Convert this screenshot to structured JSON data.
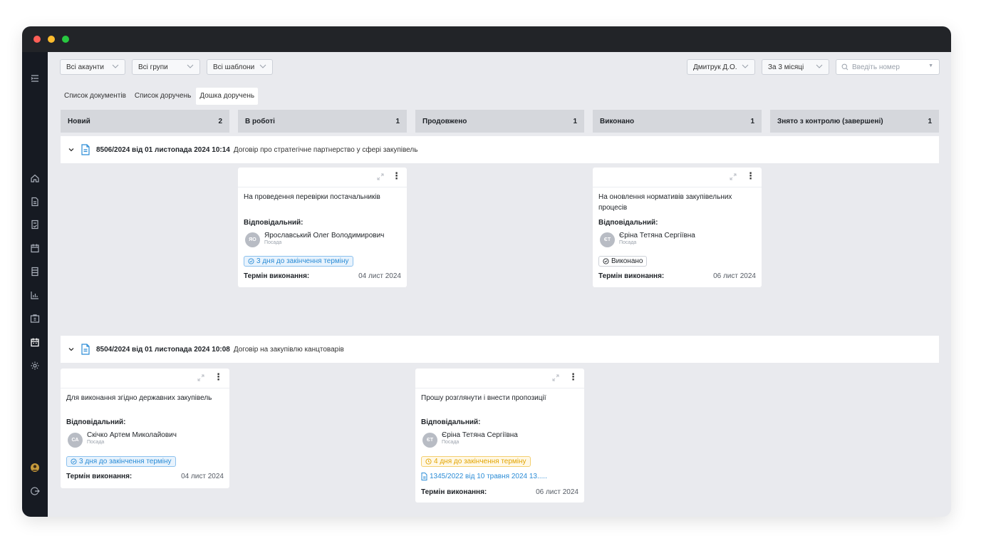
{
  "filters": {
    "accounts": "Всі акаунти",
    "groups": "Всі групи",
    "templates": "Всі шаблони",
    "user": "Дмитрук Д.О.",
    "period": "За 3 місяці",
    "search_placeholder": "Введіть номер"
  },
  "tabs": [
    {
      "label": "Список документів",
      "active": false
    },
    {
      "label": "Список доручень",
      "active": false
    },
    {
      "label": "Дошка доручень",
      "active": true
    }
  ],
  "columns": [
    {
      "label": "Новий",
      "count": "2"
    },
    {
      "label": "В роботі",
      "count": "1"
    },
    {
      "label": "Продовжено",
      "count": "1"
    },
    {
      "label": "Виконано",
      "count": "1"
    },
    {
      "label": "Знято з контролю (завершені)",
      "count": "1"
    }
  ],
  "groups": [
    {
      "number": "8506/2024 від 01 листопада 2024 10:14",
      "title": "Договір про стратегічне партнерство у сфері закупівель",
      "cards": [
        {
          "column": "В роботі",
          "title": "На проведення перевірки постачальників",
          "responsible_label": "Відповідальний:",
          "initials": "ЯО",
          "person": "Ярославський Олег Володимирович",
          "position": "Посада",
          "badge": "3 дня до закінчення терміну",
          "badge_type": "blue",
          "term_label": "Термін виконання:",
          "term_date": "04 лист 2024"
        },
        {
          "column": "Виконано",
          "title": "На оновлення нормативів закупівельних процесів",
          "responsible_label": "Відповідальний:",
          "initials": "ЄТ",
          "person": "Єріна Тетяна Сергіївна",
          "position": "Посада",
          "badge": "Виконано",
          "badge_type": "grey",
          "term_label": "Термін виконання:",
          "term_date": "06 лист 2024"
        }
      ]
    },
    {
      "number": "8504/2024 від 01 листопада 2024 10:08",
      "title": "Договір на закупівлю канцтоварів",
      "cards": [
        {
          "column": "Новий",
          "title": "Для виконання згідно державних закупівель",
          "responsible_label": "Відповідальний:",
          "initials": "СА",
          "person": "Скічко Артем Миколайович",
          "position": "Посада",
          "badge": "3 дня до закінчення терміну",
          "badge_type": "blue",
          "term_label": "Термін виконання:",
          "term_date": "04 лист 2024"
        },
        {
          "column": "Продовжено",
          "title": "Прошу розглянути і внести пропозиції",
          "responsible_label": "Відповідальний:",
          "initials": "ЄТ",
          "person": "Єріна Тетяна Сергіївна",
          "position": "Посада",
          "badge": "4 дня до закінчення терміну",
          "badge_type": "orange",
          "linked_doc": "1345/2022 від 10 травня 2024 13.....",
          "term_label": "Термін виконання:",
          "term_date": "06 лист 2024"
        }
      ]
    }
  ],
  "colors": {
    "sidebar": "#161a22",
    "titlebar": "#222428",
    "board_bg": "#e9eaee",
    "column_header": "#d5d7dc",
    "accent_blue": "#2b8cd6",
    "warning": "#e2a400"
  },
  "sidebar_icons": [
    "menu-collapse-icon",
    "home-icon",
    "document-icon",
    "document-check-icon",
    "calendar-icon",
    "list-icon",
    "chart-icon",
    "id-card-icon",
    "board-icon",
    "settings-icon",
    "user-avatar",
    "logout-icon"
  ]
}
